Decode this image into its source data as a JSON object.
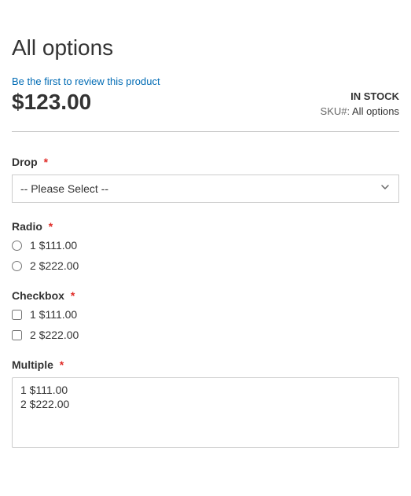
{
  "title": "All options",
  "review_link": "Be the first to review this product",
  "price": "$123.00",
  "stock_status": "IN STOCK",
  "sku_label": "SKU#:",
  "sku_value": "All options",
  "required_mark": "*",
  "options": {
    "drop": {
      "label": "Drop",
      "placeholder": "-- Please Select --"
    },
    "radio": {
      "label": "Radio",
      "items": [
        {
          "text": "1 $111.00"
        },
        {
          "text": "2 $222.00"
        }
      ]
    },
    "checkbox": {
      "label": "Checkbox",
      "items": [
        {
          "text": "1 $111.00"
        },
        {
          "text": "2 $222.00"
        }
      ]
    },
    "multiple": {
      "label": "Multiple",
      "items": [
        {
          "text": "1 $111.00"
        },
        {
          "text": "2 $222.00"
        }
      ]
    }
  }
}
